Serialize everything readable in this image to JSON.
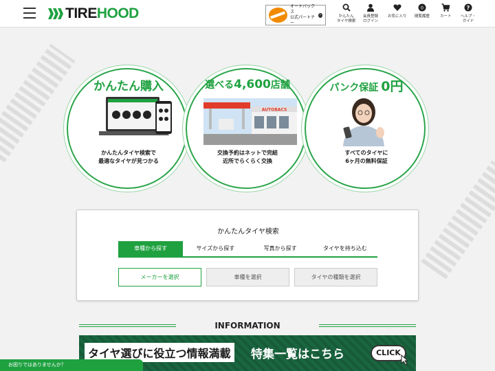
{
  "header": {
    "logo": {
      "part1": "TIRE",
      "part2": "HOOD"
    },
    "partner": {
      "line1": "オートバックス",
      "line2": "公式パートナー",
      "brand": "AUTOBACS"
    },
    "nav": [
      {
        "line1": "かんたん",
        "line2": "タイヤ検索",
        "icon": "search-icon"
      },
      {
        "line1": "会員登録",
        "line2": "ログイン",
        "icon": "user-icon"
      },
      {
        "line1": "お気に入り",
        "line2": "",
        "icon": "heart-icon"
      },
      {
        "line1": "閲覧履歴",
        "line2": "",
        "icon": "history-icon"
      },
      {
        "line1": "カート",
        "line2": "",
        "icon": "cart-icon"
      },
      {
        "line1": "ヘルプ・",
        "line2": "ガイド",
        "icon": "help-icon"
      }
    ],
    "history_badge": "0"
  },
  "features": [
    {
      "title": "かんたん購入",
      "line1": "かんたんタイヤ検索で",
      "line2": "最適なタイヤが見つかる"
    },
    {
      "title_a": "選べる",
      "title_b": "4,600",
      "title_c": "店舗",
      "line1": "交換予約はネットで完結",
      "line2": "近所でらくらく交換",
      "sign": "AUTOBACS"
    },
    {
      "title_a": "パンク保証",
      "title_b": "0円",
      "line1": "すべてのタイヤに",
      "line2": "6ヶ月の無料保証"
    }
  ],
  "search": {
    "title": "かんたんタイヤ検索",
    "tabs": [
      "車種から探す",
      "サイズから探す",
      "写真から探す",
      "タイヤを持ち込む"
    ],
    "active_tab": 0,
    "selects": [
      "メーカーを選択",
      "車種を選択",
      "タイヤの種類を選択"
    ]
  },
  "information": {
    "title": "INFORMATION",
    "banner_left": "タイヤ選びに役立つ情報満載",
    "banner_right": "特集一覧はこちら",
    "banner_click": "CLICK"
  },
  "help_bar": "お困りではありませんか？",
  "colors": {
    "brand_green": "#1fa140",
    "accent_orange": "#f28a00"
  }
}
